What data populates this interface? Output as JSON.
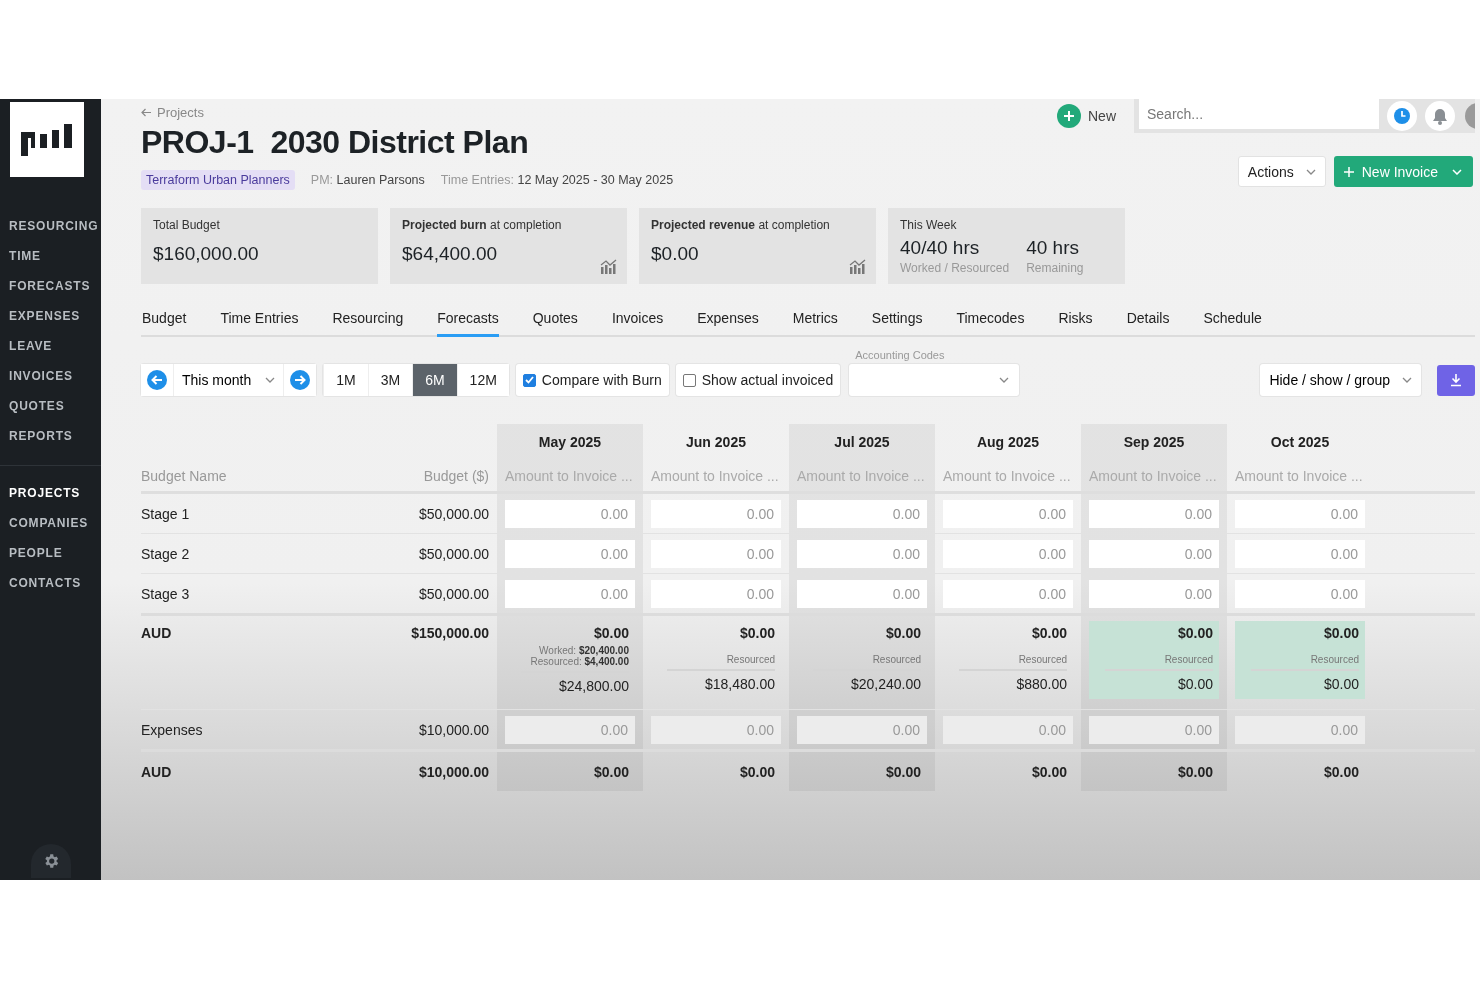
{
  "sidebar": {
    "groups": [
      {
        "items": [
          {
            "label": "RESOURCING",
            "selected": false
          },
          {
            "label": "TIME",
            "selected": false
          },
          {
            "label": "FORECASTS",
            "selected": false
          },
          {
            "label": "EXPENSES",
            "selected": false
          },
          {
            "label": "LEAVE",
            "selected": false
          },
          {
            "label": "INVOICES",
            "selected": false
          },
          {
            "label": "QUOTES",
            "selected": false
          },
          {
            "label": "REPORTS",
            "selected": false
          }
        ]
      },
      {
        "items": [
          {
            "label": "PROJECTS",
            "selected": true
          },
          {
            "label": "COMPANIES",
            "selected": false
          },
          {
            "label": "PEOPLE",
            "selected": false
          },
          {
            "label": "CONTACTS",
            "selected": false
          }
        ]
      }
    ]
  },
  "top_bar": {
    "new_button": "New",
    "search": {
      "placeholder": "Search..."
    }
  },
  "breadcrumb": "Projects",
  "title": {
    "code": "PROJ-1",
    "name": "2030 District Plan"
  },
  "company_tag": "Terraform Urban Planners",
  "meta": [
    {
      "label": "PM:",
      "value": "Lauren Parsons"
    },
    {
      "label": "Time Entries:",
      "value": "12 May 2025 - 30 May 2025"
    }
  ],
  "header_buttons": {
    "actions": "Actions",
    "new_invoice": "New Invoice"
  },
  "cards": [
    {
      "kind": "money",
      "title": "Total Budget",
      "value": "$160,000.00",
      "chart_icon": false
    },
    {
      "kind": "money",
      "title": "**Projected burn** at completion",
      "value": "$64,400.00",
      "chart_icon": true
    },
    {
      "kind": "money",
      "title": "**Projected revenue** at completion",
      "value": "$0.00",
      "chart_icon": true
    },
    {
      "kind": "hours",
      "title": "This Week",
      "stats": [
        {
          "value": "40/40 hrs",
          "label": "Worked / Resourced"
        },
        {
          "value": "40 hrs",
          "label": "Remaining"
        }
      ]
    }
  ],
  "tabs": [
    {
      "label": "Budget",
      "selected": false
    },
    {
      "label": "Time Entries",
      "selected": false
    },
    {
      "label": "Resourcing",
      "selected": false
    },
    {
      "label": "Forecasts",
      "selected": true
    },
    {
      "label": "Quotes",
      "selected": false
    },
    {
      "label": "Invoices",
      "selected": false
    },
    {
      "label": "Expenses",
      "selected": false
    },
    {
      "label": "Metrics",
      "selected": false
    },
    {
      "label": "Settings",
      "selected": false
    },
    {
      "label": "Timecodes",
      "selected": false
    },
    {
      "label": "Risks",
      "selected": false
    },
    {
      "label": "Details",
      "selected": false
    },
    {
      "label": "Schedule",
      "selected": false
    }
  ],
  "toolbar": {
    "period": "This month",
    "ranges": [
      {
        "label": "1M",
        "selected": false
      },
      {
        "label": "3M",
        "selected": false
      },
      {
        "label": "6M",
        "selected": true
      },
      {
        "label": "12M",
        "selected": false
      }
    ],
    "checkboxes": [
      {
        "label": "Compare with Burn",
        "checked": true
      },
      {
        "label": "Show actual invoiced",
        "checked": false
      }
    ],
    "accounting_codes": {
      "label": "Accounting Codes"
    },
    "group_button": "Hide / show / group"
  },
  "table": {
    "columns": {
      "name": "Budget Name",
      "budget": "Budget ($)"
    },
    "months": [
      {
        "label": "May 2025",
        "sub": "Amount to Invoice ...",
        "shaded": true
      },
      {
        "label": "Jun 2025",
        "sub": "Amount to Invoice ...",
        "shaded": false
      },
      {
        "label": "Jul 2025",
        "sub": "Amount to Invoice ...",
        "shaded": true
      },
      {
        "label": "Aug 2025",
        "sub": "Amount to Invoice ...",
        "shaded": false
      },
      {
        "label": "Sep 2025",
        "sub": "Amount to Invoice ...",
        "shaded": true
      },
      {
        "label": "Oct 2025",
        "sub": "Amount to Invoice ...",
        "shaded": false
      }
    ],
    "rows": [
      {
        "kind": "stage",
        "name": "Stage 1",
        "budget": "$50,000.00",
        "cells": [
          "0.00",
          "0.00",
          "0.00",
          "0.00",
          "0.00",
          "0.00"
        ]
      },
      {
        "kind": "stage",
        "name": "Stage 2",
        "budget": "$50,000.00",
        "cells": [
          "0.00",
          "0.00",
          "0.00",
          "0.00",
          "0.00",
          "0.00"
        ]
      },
      {
        "kind": "stage",
        "name": "Stage 3",
        "budget": "$50,000.00",
        "cells": [
          "0.00",
          "0.00",
          "0.00",
          "0.00",
          "0.00",
          "0.00"
        ]
      },
      {
        "kind": "total",
        "name": "AUD",
        "budget": "$150,000.00",
        "cells": [
          {
            "amount": "$0.00",
            "notes": [
              "Worked: **$20,400.00**",
              "Resourced: **$4,400.00**"
            ],
            "burn": "$24,800.00",
            "highlight": false
          },
          {
            "amount": "$0.00",
            "notes": [
              "Resourced"
            ],
            "burn": "$18,480.00",
            "highlight": false
          },
          {
            "amount": "$0.00",
            "notes": [
              "Resourced"
            ],
            "burn": "$20,240.00",
            "highlight": false
          },
          {
            "amount": "$0.00",
            "notes": [
              "Resourced"
            ],
            "burn": "$880.00",
            "highlight": false
          },
          {
            "amount": "$0.00",
            "notes": [
              "Resourced"
            ],
            "burn": "$0.00",
            "highlight": true
          },
          {
            "amount": "$0.00",
            "notes": [
              "Resourced"
            ],
            "burn": "$0.00",
            "highlight": true
          }
        ]
      },
      {
        "kind": "expense",
        "name": "Expenses",
        "budget": "$10,000.00",
        "cells": [
          "0.00",
          "0.00",
          "0.00",
          "0.00",
          "0.00",
          "0.00"
        ]
      },
      {
        "kind": "subtotal",
        "name": "AUD",
        "budget": "$10,000.00",
        "cells": [
          "$0.00",
          "$0.00",
          "$0.00",
          "$0.00",
          "$0.00",
          "$0.00"
        ]
      }
    ]
  }
}
